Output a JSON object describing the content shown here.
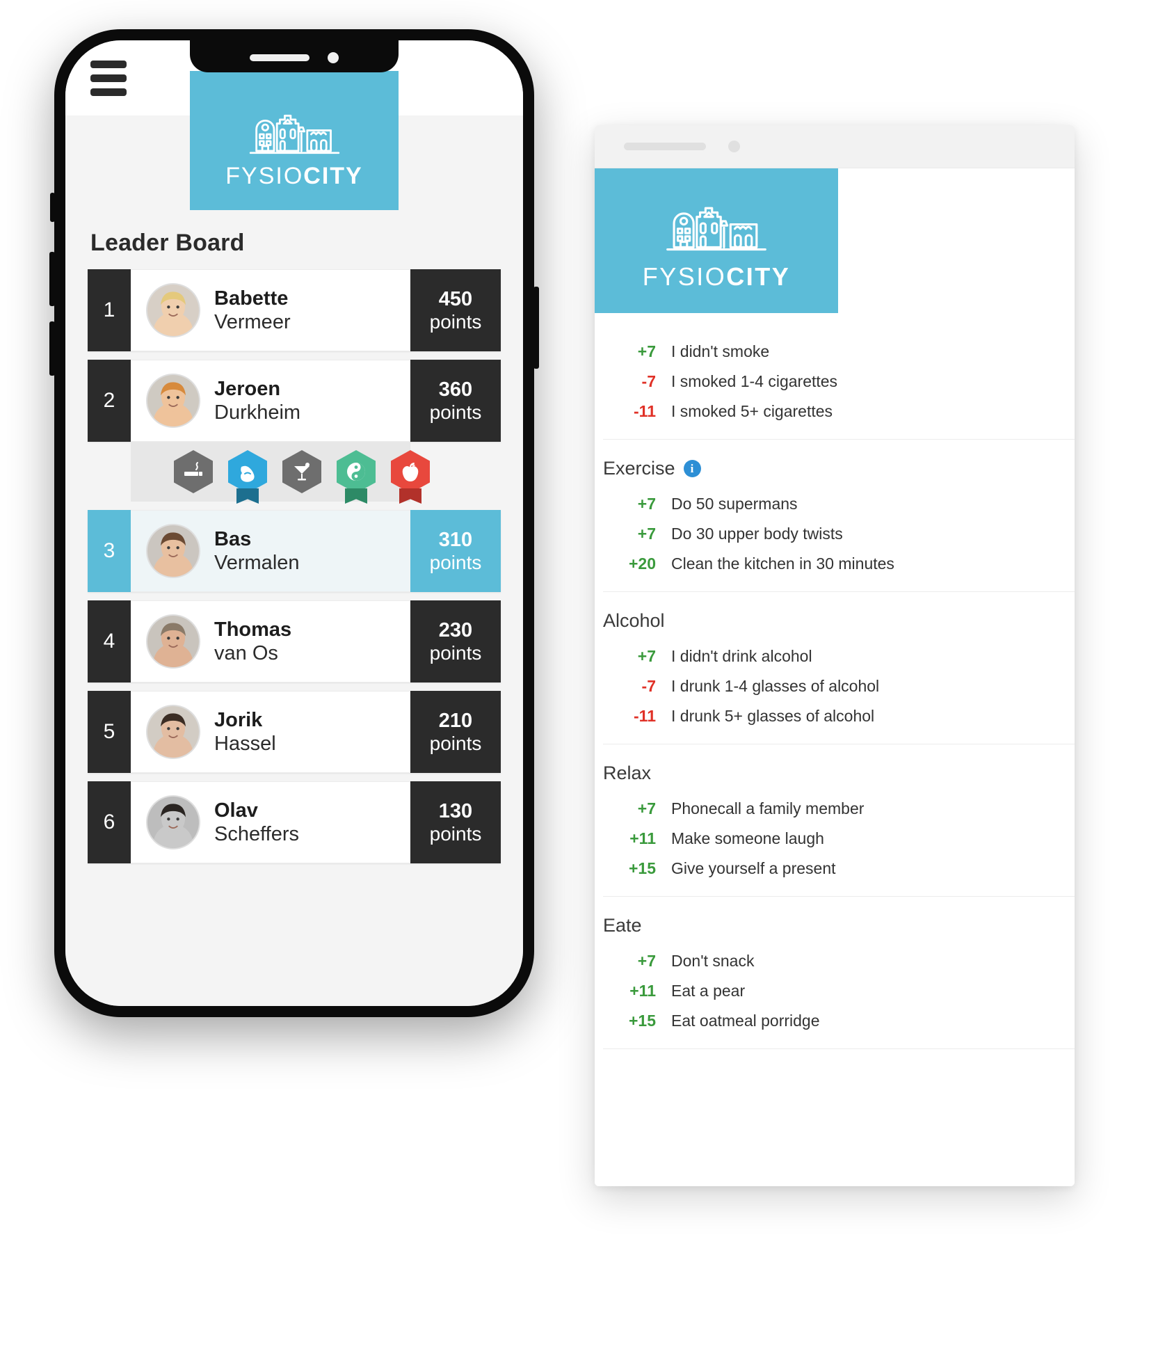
{
  "brand": {
    "name_part1": "FYSIO",
    "name_part2": "CITY",
    "accent_color": "#5cbcd8",
    "logo_icon": "canal-houses-icon"
  },
  "phone": {
    "menu_icon": "hamburger-menu-icon",
    "board_title": "Leader Board",
    "points_unit": "points",
    "leaderboard": [
      {
        "rank": "1",
        "first": "Babette",
        "last": "Vermeer",
        "points": "450",
        "unit": "points",
        "active": false,
        "avatar": "avatar-babette"
      },
      {
        "rank": "2",
        "first": "Jeroen",
        "last": "Durkheim",
        "points": "360",
        "unit": "points",
        "active": false,
        "avatar": "avatar-jeroen"
      },
      {
        "rank": "3",
        "first": "Bas",
        "last": "Vermalen",
        "points": "310",
        "unit": "points",
        "active": true,
        "avatar": "avatar-bas"
      },
      {
        "rank": "4",
        "first": "Thomas",
        "last": "van Os",
        "points": "230",
        "unit": "points",
        "active": false,
        "avatar": "avatar-thomas"
      },
      {
        "rank": "5",
        "first": "Jorik",
        "last": "Hassel",
        "points": "210",
        "unit": "points",
        "active": false,
        "avatar": "avatar-jorik"
      },
      {
        "rank": "6",
        "first": "Olav",
        "last": "Scheffers",
        "points": "130",
        "unit": "points",
        "active": false,
        "avatar": "avatar-olav"
      }
    ],
    "badges": [
      {
        "name": "cigarette-badge",
        "color": "#6e6e6e",
        "ribbon": null
      },
      {
        "name": "muscle-badge",
        "color": "#2fa8dd",
        "ribbon": "#1d6f8f"
      },
      {
        "name": "cocktail-badge",
        "color": "#6e6e6e",
        "ribbon": null
      },
      {
        "name": "yin-yang-badge",
        "color": "#4dbd93",
        "ribbon": "#2d8a66"
      },
      {
        "name": "apple-badge",
        "color": "#e8483d",
        "ribbon": "#b2312a"
      }
    ]
  },
  "panel": {
    "chrome": {
      "address_bar": "",
      "dot": ""
    },
    "sections": [
      {
        "title": "Smoke",
        "title_visible": false,
        "info": false,
        "items": [
          {
            "value": "+7",
            "sign": "pos",
            "label": "I didn't smoke"
          },
          {
            "value": "-7",
            "sign": "neg",
            "label": "I smoked 1-4 cigarettes"
          },
          {
            "value": "-11",
            "sign": "neg",
            "label": "I smoked 5+ cigarettes"
          }
        ]
      },
      {
        "title": "Exercise",
        "title_visible": true,
        "info": true,
        "info_icon": "info-icon",
        "items": [
          {
            "value": "+7",
            "sign": "pos",
            "label": "Do 50 supermans"
          },
          {
            "value": "+7",
            "sign": "pos",
            "label": "Do 30 upper body twists"
          },
          {
            "value": "+20",
            "sign": "pos",
            "label": "Clean the kitchen in 30 minutes"
          }
        ]
      },
      {
        "title": "Alcohol",
        "title_visible": true,
        "info": false,
        "items": [
          {
            "value": "+7",
            "sign": "pos",
            "label": "I didn't drink alcohol"
          },
          {
            "value": "-7",
            "sign": "neg",
            "label": "I drunk 1-4 glasses of alcohol"
          },
          {
            "value": "-11",
            "sign": "neg",
            "label": "I drunk 5+ glasses of alcohol"
          }
        ]
      },
      {
        "title": "Relax",
        "title_visible": true,
        "info": false,
        "items": [
          {
            "value": "+7",
            "sign": "pos",
            "label": "Phonecall a family member"
          },
          {
            "value": "+11",
            "sign": "pos",
            "label": "Make someone laugh"
          },
          {
            "value": "+15",
            "sign": "pos",
            "label": "Give yourself a present"
          }
        ]
      },
      {
        "title": "Eate",
        "title_visible": true,
        "info": false,
        "items": [
          {
            "value": "+7",
            "sign": "pos",
            "label": "Don't snack"
          },
          {
            "value": "+11",
            "sign": "pos",
            "label": "Eat a pear"
          },
          {
            "value": "+15",
            "sign": "pos",
            "label": "Eat oatmeal porridge"
          }
        ]
      }
    ]
  },
  "colors": {
    "accent": "#5cbcd8",
    "dark": "#2b2b2b",
    "positive": "#3a9a3c",
    "negative": "#e03127",
    "page_bg": "#f4f4f4"
  }
}
